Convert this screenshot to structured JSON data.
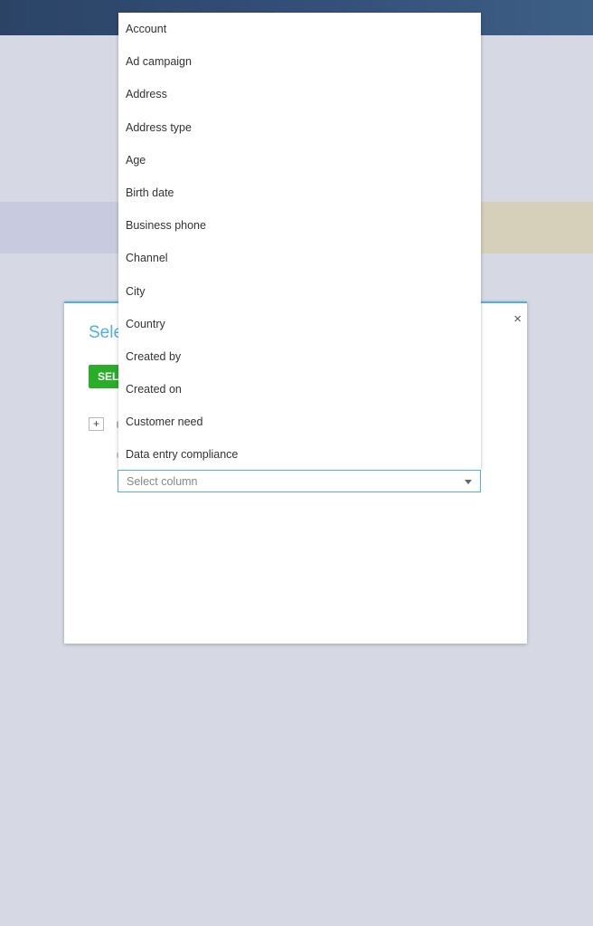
{
  "modal": {
    "title": "Select",
    "close_glyph": "×",
    "select_button_label": "SELECT",
    "expand_glyph": "+"
  },
  "column_select": {
    "placeholder": "Select column",
    "options": [
      "Account",
      "Ad campaign",
      "Address",
      "Address type",
      "Age",
      "Birth date",
      "Business phone",
      "Channel",
      "City",
      "Country",
      "Created by",
      "Created on",
      "Customer need",
      "Data entry compliance"
    ]
  },
  "colors": {
    "accent": "#4fb3d9",
    "button_green": "#2aae2a",
    "header": "#2b4466",
    "background": "#d6d8e3"
  },
  "icons": {
    "close": "close-icon",
    "expand": "plus-icon",
    "dropdown_caret": "chevron-down-icon"
  }
}
